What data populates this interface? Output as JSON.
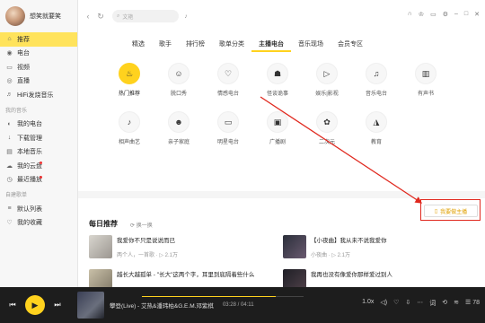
{
  "profile": {
    "name": "想笑就要笑"
  },
  "sidebar": {
    "items": [
      {
        "label": "推荐",
        "icon": "home-icon",
        "glyph": "⌂"
      },
      {
        "label": "电台",
        "icon": "radio-icon",
        "glyph": "◉"
      },
      {
        "label": "视频",
        "icon": "video-icon",
        "glyph": "▭"
      },
      {
        "label": "直播",
        "icon": "live-icon",
        "glyph": "◎"
      },
      {
        "label": "HiFi发烧音乐",
        "icon": "hifi-icon",
        "glyph": "♬"
      }
    ],
    "my_section": "我的音乐",
    "my_items": [
      {
        "label": "我的电台",
        "icon": "my-radio-icon",
        "glyph": "◐"
      },
      {
        "label": "下载管理",
        "icon": "download-icon",
        "glyph": "↓"
      },
      {
        "label": "本地音乐",
        "icon": "local-music-icon",
        "glyph": "▤"
      },
      {
        "label": "我的云盘",
        "icon": "cloud-icon",
        "glyph": "☁"
      },
      {
        "label": "最近播放",
        "icon": "recent-icon",
        "glyph": "◷"
      }
    ],
    "playlist_section": "自建歌单",
    "playlist_items": [
      {
        "label": "默认列表",
        "icon": "list-icon",
        "glyph": "≡"
      },
      {
        "label": "我的收藏",
        "icon": "heart-icon",
        "glyph": "♡"
      }
    ]
  },
  "search": {
    "placeholder": "文艳"
  },
  "tabs": [
    "精选",
    "歌手",
    "排行榜",
    "歌单分类",
    "主播电台",
    "音乐现场",
    "会员专区"
  ],
  "active_tab": "主播电台",
  "categories": [
    {
      "label": "热门推荐",
      "icon": "hot-icon",
      "glyph": "♨"
    },
    {
      "label": "脱口秀",
      "icon": "talkshow-icon",
      "glyph": "☺"
    },
    {
      "label": "情感电台",
      "icon": "emotion-icon",
      "glyph": "♡"
    },
    {
      "label": "怪谈诡事",
      "icon": "ghost-icon",
      "glyph": "☗"
    },
    {
      "label": "娱乐|影视",
      "icon": "film-icon",
      "glyph": "▷"
    },
    {
      "label": "音乐电台",
      "icon": "music-note-icon",
      "glyph": "♫"
    },
    {
      "label": "有声书",
      "icon": "book-icon",
      "glyph": "▥"
    },
    {
      "label": "相声曲艺",
      "icon": "crosstalk-icon",
      "glyph": "♪"
    },
    {
      "label": "亲子家庭",
      "icon": "family-icon",
      "glyph": "☻"
    },
    {
      "label": "明星电台",
      "icon": "star-icon",
      "glyph": "▭"
    },
    {
      "label": "广播剧",
      "icon": "broadcast-icon",
      "glyph": "▣"
    },
    {
      "label": "二次元",
      "icon": "anime-icon",
      "glyph": "✿"
    },
    {
      "label": "教育",
      "icon": "education-icon",
      "glyph": "◮"
    }
  ],
  "anchor_button": "我要做主播",
  "daily": {
    "title": "每日推荐",
    "refresh": "换一换"
  },
  "recs": [
    {
      "title": "我爱你不只是说说而已",
      "sub": "两个人，一首歌",
      "plays": "2.1万"
    },
    {
      "title": "【小夜曲】我从未不说我爱你",
      "sub": "小夜曲",
      "plays": "2.1万"
    },
    {
      "title": "越长大越孤单 - \"长大\"这两个字，耳里到底隔着些什么",
      "sub": "",
      "plays": ""
    },
    {
      "title": "我再也没有像爱你那样爱过别人",
      "sub": "",
      "plays": ""
    }
  ],
  "player": {
    "title": "攀登(Live) - 艾热&潘玮柏&G.E.M.邓紫棋",
    "current": "03:28",
    "total": "04:11",
    "progress": 0.83,
    "speed": "1.0x",
    "count": "78"
  },
  "colors": {
    "accent": "#ffd21e",
    "highlight": "#e0281e"
  }
}
